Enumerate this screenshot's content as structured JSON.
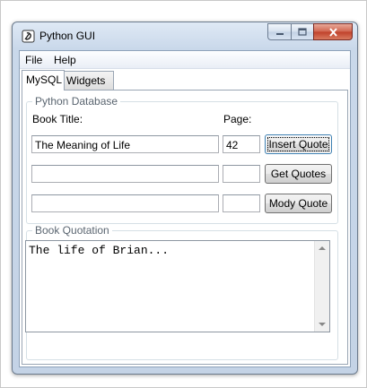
{
  "window": {
    "title": "Python GUI"
  },
  "menubar": {
    "items": [
      {
        "label": "File"
      },
      {
        "label": "Help"
      }
    ]
  },
  "tabs": [
    {
      "label": "MySQL",
      "active": true
    },
    {
      "label": "Widgets",
      "active": false
    }
  ],
  "database_group": {
    "title": "Python Database",
    "book_title_label": "Book Title:",
    "page_label": "Page:",
    "rows": [
      {
        "title_value": "The Meaning of Life",
        "page_value": "42",
        "button_label": "Insert Quote"
      },
      {
        "title_value": "",
        "page_value": "",
        "button_label": "Get Quotes"
      },
      {
        "title_value": "",
        "page_value": "",
        "button_label": "Mody Quote"
      }
    ]
  },
  "quotation_group": {
    "title": "Book Quotation",
    "text": "The life of Brian..."
  },
  "icons": {
    "app": "python-feather-icon",
    "minimize": "minimize-icon",
    "maximize": "maximize-icon",
    "close": "close-icon",
    "scroll_up": "scroll-up-arrow-icon",
    "scroll_down": "scroll-down-arrow-icon"
  }
}
